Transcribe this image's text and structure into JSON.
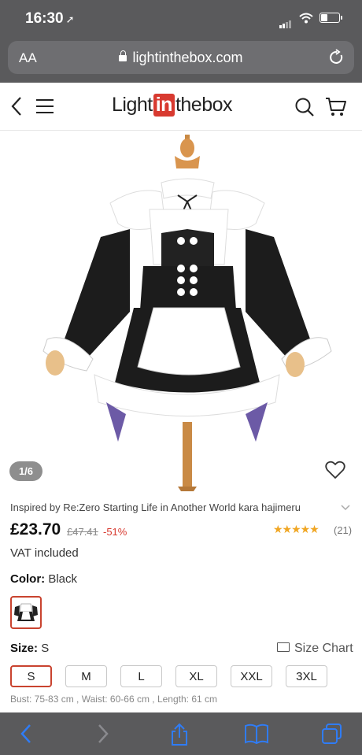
{
  "status": {
    "time": "16:30"
  },
  "browser": {
    "aa": "AA",
    "url": "lightinthebox.com"
  },
  "site": {
    "logo_pre": "Light",
    "logo_in": "in",
    "logo_post": "thebox"
  },
  "gallery": {
    "pager": "1/6"
  },
  "product": {
    "title": "Inspired by Re:Zero Starting Life in Another World kara hajimeru",
    "price": "£23.70",
    "old_price": "£47.41",
    "discount": "-51%",
    "rating_stars": "★★★★★",
    "rating_value": 5,
    "review_count": "(21)",
    "vat": "VAT included"
  },
  "color": {
    "label": "Color:",
    "value": "Black"
  },
  "size": {
    "label": "Size:",
    "value": "S",
    "chart_label": "Size Chart",
    "options": [
      "S",
      "M",
      "L",
      "XL",
      "XXL",
      "3XL"
    ],
    "selected": "S",
    "measurements": "Bust: 75-83 cm , Waist: 60-66 cm , Length: 61 cm"
  },
  "colors": {
    "accent": "#c9432f",
    "logo_red": "#d83a30",
    "star": "#f0a623",
    "bar": "#5a5a5c",
    "ios_blue": "#2f7cf6"
  }
}
